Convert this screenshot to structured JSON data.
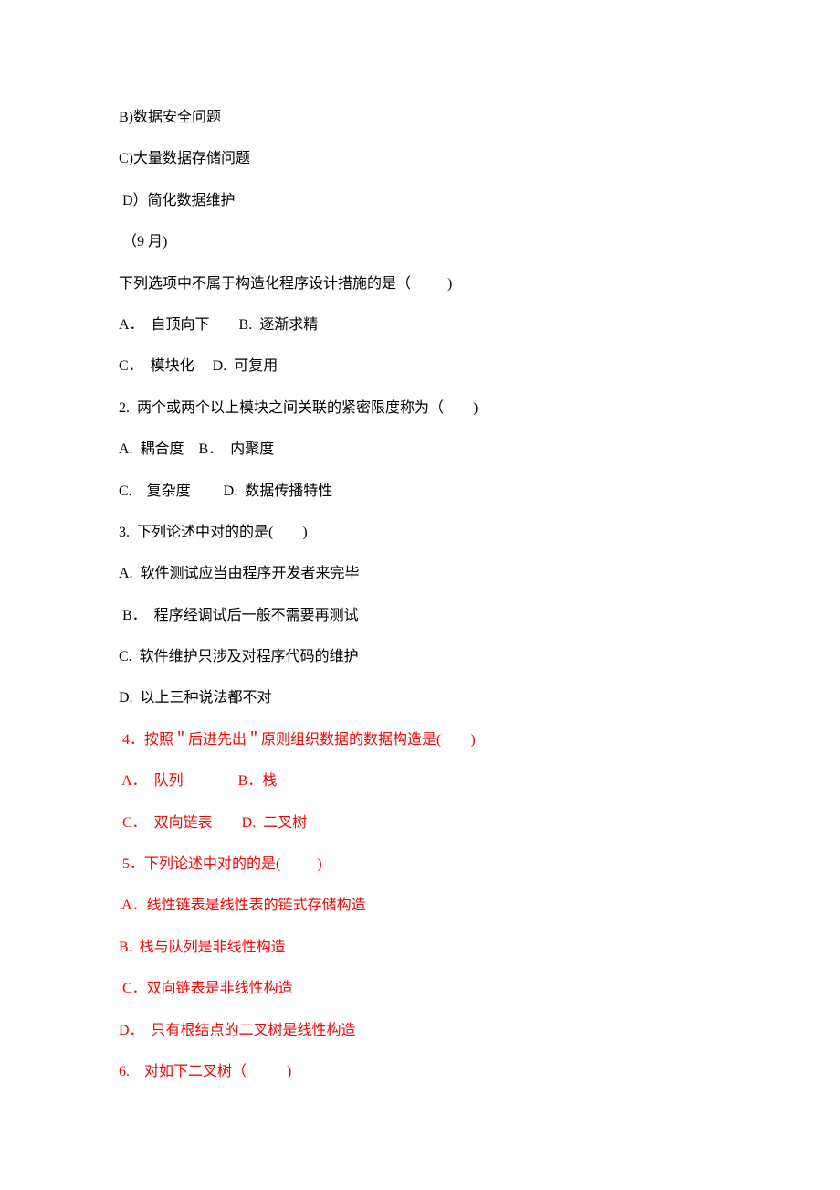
{
  "lines": [
    {
      "text": "B)数据安全问题",
      "red": false
    },
    {
      "text": "C)大量数据存储问题",
      "red": false
    },
    {
      "text": " D）简化数据维护",
      "red": false
    },
    {
      "text": " （9 月)",
      "red": false
    },
    {
      "text": "下列选项中不属于构造化程序设计措施的是（          )",
      "red": false
    },
    {
      "text": "A．  自顶向下    ﻿﻿    B.  逐渐求精",
      "red": false
    },
    {
      "text": "C．  模块化 ﻿﻿﻿    D.  可复用",
      "red": false
    },
    {
      "text": "2.  两个或两个以上模块之间关联的紧密限度称为（        )",
      "red": false
    },
    {
      "text": "A.  耦合度    ﻿﻿﻿B．  内聚度",
      "red": false
    },
    {
      "text": "C.    复杂度         ﻿﻿D.  数据传播特性",
      "red": false
    },
    {
      "text": "3.  下列论述中对的的是(        )",
      "red": false
    },
    {
      "text": "A.  软件测试应当由程序开发者来完毕",
      "red": false
    },
    {
      "text": " B．  程序经调试后一般不需要再测试",
      "red": false
    },
    {
      "text": "C.  软件维护只涉及对程序代码的维护",
      "red": false
    },
    {
      "text": "D.  以上三种说法都不对",
      "red": false
    },
    {
      "text": " 4．按照＂后进先出＂原则组织数据的数据构造是(        )",
      "red": true
    },
    {
      "text": " A．  队列    ﻿﻿           B．栈",
      "red": true
    },
    {
      "text": " C．  双向链表    ﻿    ﻿D.  二叉树",
      "red": true
    },
    {
      "text": " 5．下列论述中对的的是(          )",
      "red": true
    },
    {
      "text": " A．线性链表是线性表的链式存储构造",
      "red": true
    },
    {
      "text": "B.  栈与队列是非线性构造",
      "red": true
    },
    {
      "text": " C．双向链表是非线性构造",
      "red": true
    },
    {
      "text": "D．  只有根结点的二叉树是线性构造",
      "red": true
    },
    {
      "text": "6.    对如下二叉树（           )",
      "red": true
    }
  ]
}
